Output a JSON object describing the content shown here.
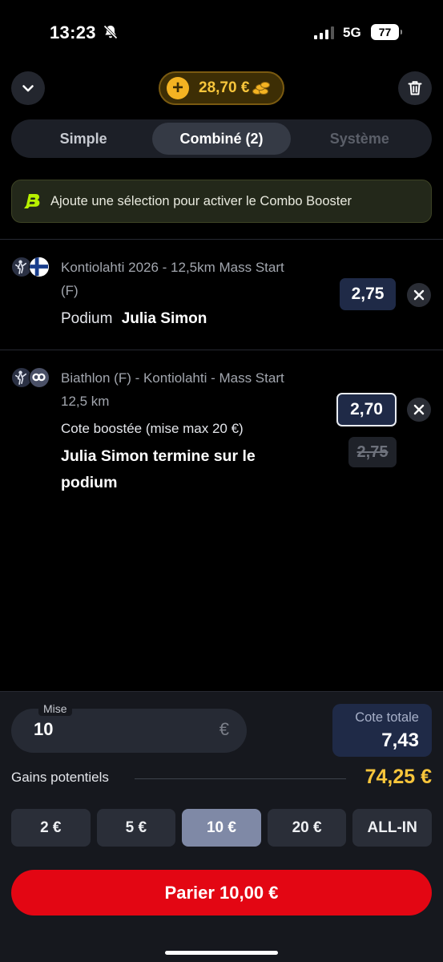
{
  "status": {
    "time": "13:23",
    "network": "5G",
    "battery": "77"
  },
  "header": {
    "balance": "28,70 €"
  },
  "tabs": [
    {
      "label": "Simple",
      "state": "normal"
    },
    {
      "label": "Combiné (2)",
      "state": "active"
    },
    {
      "label": "Système",
      "state": "disabled"
    }
  ],
  "booster": {
    "text": "Ajoute une sélection pour activer le Combo Booster"
  },
  "selections": [
    {
      "event_line1": "Kontiolahti 2026 - 12,5km Mass Start",
      "event_line2": "(F)",
      "market": "Podium",
      "pick": "Julia Simon",
      "odds": "2,75"
    },
    {
      "event_line1": "Biathlon (F) - Kontiolahti - Mass Start",
      "event_line2": "12,5 km",
      "market": "Cote boostée (mise max 20 €)",
      "pick_line1": "Julia Simon termine sur le",
      "pick_line2": "podium",
      "odds": "2,70",
      "old_odds": "2,75"
    }
  ],
  "betslip": {
    "stake_label": "Mise",
    "stake_value": "10",
    "currency": "€",
    "total_odds_label": "Cote totale",
    "total_odds": "7,43",
    "gains_label": "Gains potentiels",
    "gains_value": "74,25 €",
    "quick_stakes": [
      "2 €",
      "5 €",
      "10 €",
      "20 €",
      "ALL-IN"
    ],
    "cta": "Parier 10,00 €"
  },
  "colors": {
    "accent_gold": "#f7c53b",
    "cta_red": "#e30613",
    "booster_green": "#b7f000",
    "odds_navy": "#1f2a47"
  }
}
